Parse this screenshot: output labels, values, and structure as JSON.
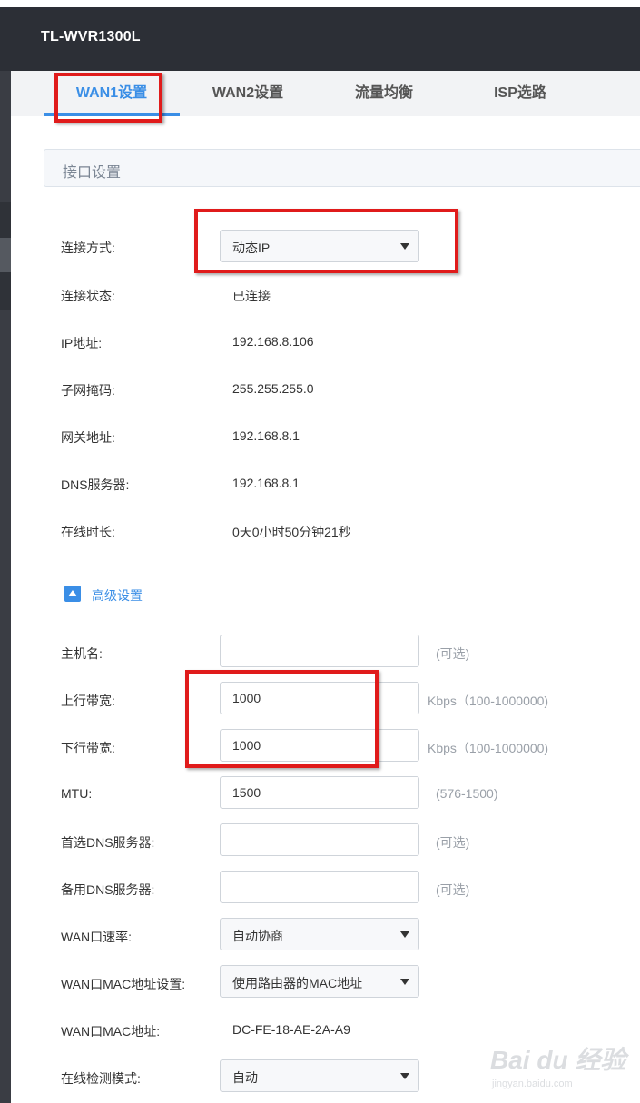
{
  "app": {
    "title": "TL-WVR1300L"
  },
  "tabs": [
    {
      "label": "WAN1设置",
      "active": true
    },
    {
      "label": "WAN2设置",
      "active": false
    },
    {
      "label": "流量均衡",
      "active": false
    },
    {
      "label": "ISP选路",
      "active": false
    }
  ],
  "section": {
    "title": "接口设置"
  },
  "status": {
    "connection_type_label": "连接方式:",
    "connection_type_value": "动态IP",
    "connection_state_label": "连接状态:",
    "connection_state_value": "已连接",
    "ip_label": "IP地址:",
    "ip_value": "192.168.8.106",
    "mask_label": "子网掩码:",
    "mask_value": "255.255.255.0",
    "gateway_label": "网关地址:",
    "gateway_value": "192.168.8.1",
    "dns_label": "DNS服务器:",
    "dns_value": "192.168.8.1",
    "uptime_label": "在线时长:",
    "uptime_value": "0天0小时50分钟21秒"
  },
  "advanced": {
    "toggle_label": "高级设置",
    "hostname_label": "主机名:",
    "hostname_value": "",
    "hostname_hint": "(可选)",
    "upstream_label": "上行带宽:",
    "upstream_value": "1000",
    "upstream_hint": "Kbps（100-1000000)",
    "downstream_label": "下行带宽:",
    "downstream_value": "1000",
    "downstream_hint": "Kbps（100-1000000)",
    "mtu_label": "MTU:",
    "mtu_value": "1500",
    "mtu_hint": "(576-1500)",
    "pref_dns_label": "首选DNS服务器:",
    "pref_dns_value": "",
    "pref_dns_hint": "(可选)",
    "alt_dns_label": "备用DNS服务器:",
    "alt_dns_value": "",
    "alt_dns_hint": "(可选)",
    "wan_speed_label": "WAN口速率:",
    "wan_speed_value": "自动协商",
    "wan_mac_setting_label": "WAN口MAC地址设置:",
    "wan_mac_setting_value": "使用路由器的MAC地址",
    "wan_mac_label": "WAN口MAC地址:",
    "wan_mac_value": "DC-FE-18-AE-2A-A9",
    "detect_mode_label": "在线检测模式:",
    "detect_mode_value": "自动"
  },
  "watermark": {
    "line1": "Bai du 经验",
    "line2": "jingyan.baidu.com"
  },
  "colors": {
    "accent": "#3a8ee6",
    "topbar": "#2c2f36",
    "highlight": "#e01b1b"
  }
}
